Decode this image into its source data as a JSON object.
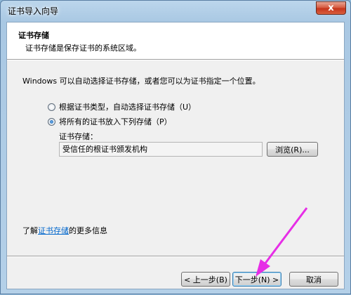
{
  "window": {
    "title": "证书导入向导",
    "close_glyph": "x"
  },
  "header": {
    "title": "证书存储",
    "subtitle": "证书存储是保存证书的系统区域。"
  },
  "main": {
    "intro": "Windows 可以自动选择证书存储，或者您可以为证书指定一个位置。",
    "option_auto": "根据证书类型，自动选择证书存储（U）",
    "option_manual": "将所有的证书放入下列存储（P）",
    "selected": "option_manual",
    "store_label": "证书存储：",
    "store_value": "受信任的根证书颁发机构",
    "browse_label": "浏览(R)...",
    "more_info_prefix": "了解",
    "more_info_link": "证书存储",
    "more_info_suffix": "的更多信息"
  },
  "footer": {
    "back_label": "< 上一步(B)",
    "next_label": "下一步(N) >",
    "cancel_label": "取消"
  },
  "colors": {
    "annotation_arrow": "#e62ee6",
    "link": "#0066cc"
  }
}
